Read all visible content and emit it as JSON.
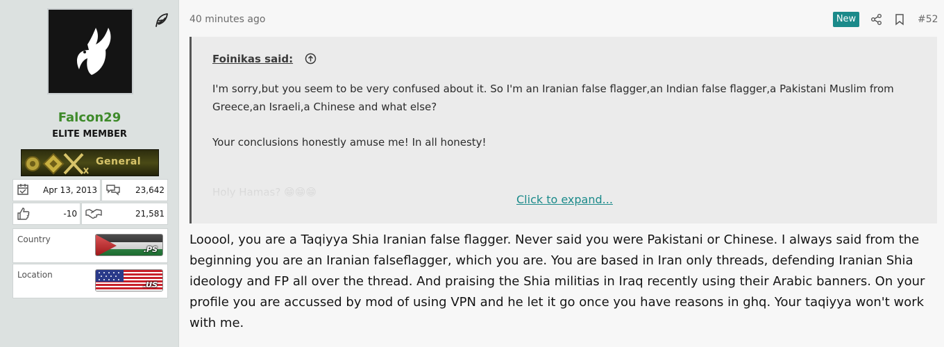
{
  "user": {
    "name": "Falcon29",
    "title": "ELITE MEMBER",
    "rank_label": "General",
    "joined": "Apr 13, 2013",
    "messages": "23,642",
    "reaction_score": "-10",
    "points": "21,581",
    "country_label": "Country",
    "country_code": ".PS",
    "location_label": "Location",
    "location_code": ".US"
  },
  "post": {
    "time": "40 minutes ago",
    "new_badge": "New",
    "number": "#52",
    "quote": {
      "author_said": "Foinikas said:",
      "paragraphs": [
        "I'm sorry,but you seem to be very confused about it. So I'm an Iranian false flagger,an Indian false flagger,a Pakistani Muslim from Greece,an Israeli,a Chinese and what else?",
        "Your conclusions honestly amuse me! In all honesty!"
      ],
      "faded_text": "Holy Hamas? 😁😁😁",
      "expand_label": "Click to expand..."
    },
    "body": "Looool, you are a Taqiyya Shia Iranian false flagger. Never said you were Pakistani or Chinese. I always said from the beginning you are an Iranian falseflagger, which you are. You are based in Iran only threads, defending Iranian Shia ideology and FP all over the thread. And praising the Shia militias in Iraq recently using their Arabic banners. On your profile you are accussed by mod of using VPN and he let it go once you have reasons in ghq. Your taqiyya won't work with me."
  },
  "colors": {
    "username": "#3e8a2a",
    "accent": "#1b8a8a",
    "sidebar_bg": "#dce1e0"
  },
  "icons": [
    "feather-icon",
    "calendar-icon",
    "messages-icon",
    "thumbs-up-icon",
    "handshake-icon",
    "share-icon",
    "bookmark-icon",
    "arrow-up-circle-icon"
  ]
}
